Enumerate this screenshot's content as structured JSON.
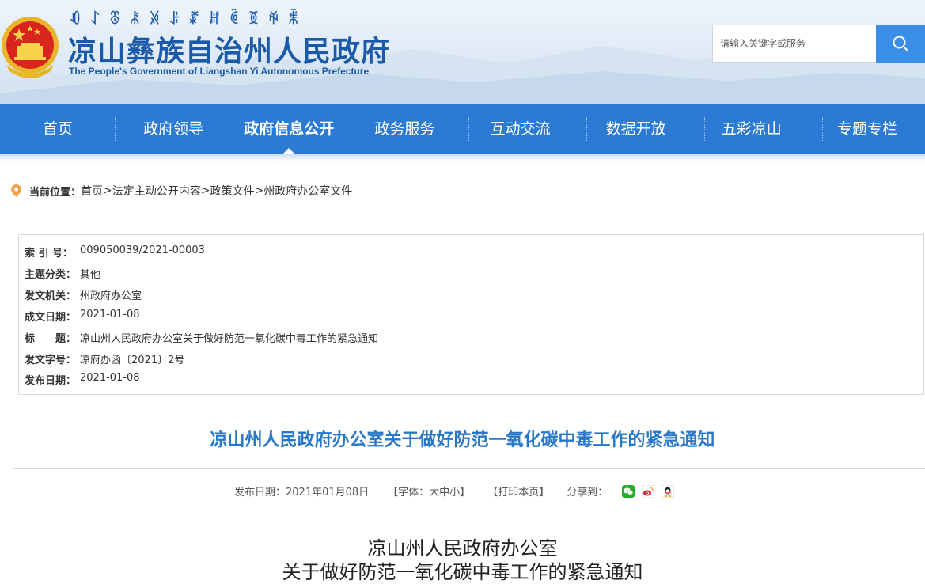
{
  "header": {
    "yi_script": "ꀒꋍꁨꂿꊉꌠꊨꏦꏱꅉꑮꐨ",
    "title": "凉山彝族自治州人民政府",
    "subtitle": "The People's Government of Liangshan Yi Autonomous Prefecture",
    "search_placeholder": "请输入关键字或服务"
  },
  "nav": {
    "items": [
      "首页",
      "政府领导",
      "政府信息公开",
      "政务服务",
      "互动交流",
      "数据开放",
      "五彩凉山",
      "专题专栏"
    ],
    "active_index": 2
  },
  "breadcrumb": {
    "label": "当前位置：",
    "path": [
      "首页",
      ">",
      "法定主动公开内容",
      ">",
      "政策文件",
      ">",
      "州政府办公室文件"
    ]
  },
  "info": [
    {
      "key": "索 引 号：",
      "value": "009050039/2021-00003"
    },
    {
      "key": "主题分类：",
      "value": "其他"
    },
    {
      "key": "发文机关：",
      "value": "州政府办公室"
    },
    {
      "key": "成文日期：",
      "value": "2021-01-08"
    },
    {
      "key": "标　　题：",
      "value": "凉山州人民政府办公室关于做好防范一氧化碳中毒工作的紧急通知"
    },
    {
      "key": "发文字号：",
      "value": "凉府办函〔2021〕2号"
    },
    {
      "key": "发布日期：",
      "value": "2021-01-08"
    }
  ],
  "article": {
    "title": "凉山州人民政府办公室关于做好防范一氧化碳中毒工作的紧急通知",
    "publish_label": "发布日期：2021年01月08日",
    "font_label": "【字体：大中小】",
    "print_label": "【打印本页】",
    "share_label": "分享到：",
    "body_line1": "凉山州人民政府办公室",
    "body_line2": "关于做好防范一氧化碳中毒工作的紧急通知"
  },
  "colors": {
    "nav_bg": "#2b7bd4",
    "title_blue": "#1b5aa9",
    "article_title": "#2878c7",
    "search_btn": "#3a8ee6"
  },
  "icons": [
    "emblem-icon",
    "search-icon",
    "location-pin-icon",
    "wechat-icon",
    "weibo-icon",
    "qq-icon"
  ]
}
